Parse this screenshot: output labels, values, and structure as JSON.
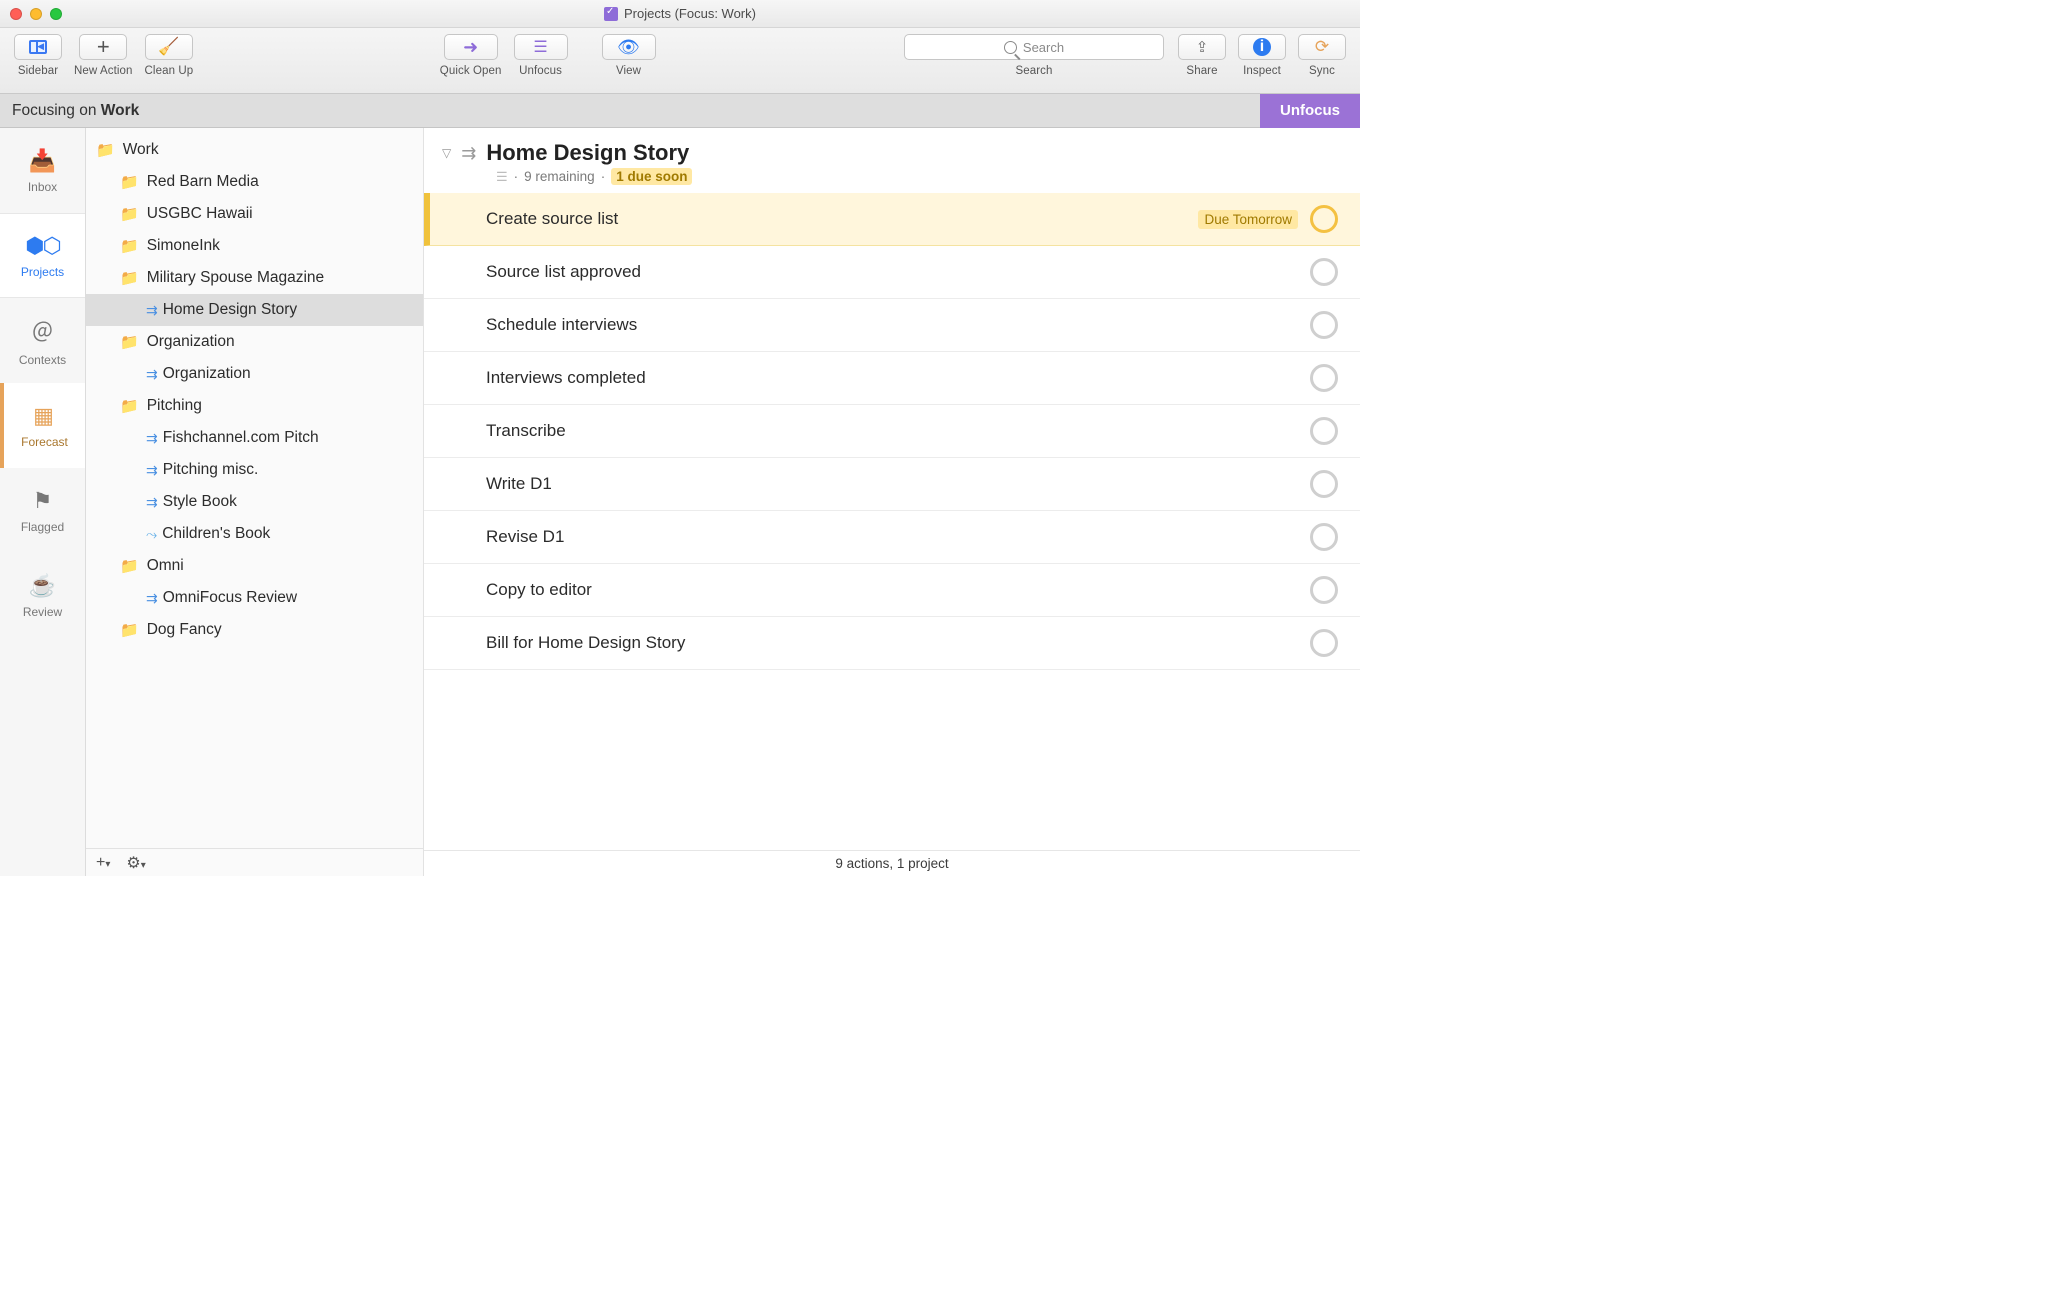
{
  "window": {
    "title": "Projects (Focus: Work)"
  },
  "toolbar": {
    "sidebar": "Sidebar",
    "new_action": "New Action",
    "clean_up": "Clean Up",
    "quick_open": "Quick Open",
    "unfocus": "Unfocus",
    "view": "View",
    "search_placeholder": "Search",
    "search_label": "Search",
    "share": "Share",
    "inspect": "Inspect",
    "sync": "Sync"
  },
  "focus_strip": {
    "prefix": "Focusing on ",
    "name": "Work",
    "unfocus": "Unfocus"
  },
  "rail": {
    "inbox": "Inbox",
    "projects": "Projects",
    "contexts": "Contexts",
    "forecast": "Forecast",
    "flagged": "Flagged",
    "review": "Review"
  },
  "projects": [
    {
      "type": "folder",
      "level": 0,
      "name": "Work"
    },
    {
      "type": "folder",
      "level": 1,
      "name": "Red Barn Media"
    },
    {
      "type": "folder",
      "level": 1,
      "name": "USGBC Hawaii"
    },
    {
      "type": "folder",
      "level": 1,
      "name": "SimoneInk"
    },
    {
      "type": "folder",
      "level": 1,
      "name": "Military Spouse Magazine"
    },
    {
      "type": "project",
      "level": 2,
      "name": "Home Design Story",
      "selected": true
    },
    {
      "type": "folder",
      "level": 1,
      "name": "Organization"
    },
    {
      "type": "project",
      "level": 2,
      "name": "Organization"
    },
    {
      "type": "folder",
      "level": 1,
      "name": "Pitching"
    },
    {
      "type": "project",
      "level": 2,
      "name": "Fishchannel.com Pitch"
    },
    {
      "type": "project",
      "level": 2,
      "name": "Pitching misc."
    },
    {
      "type": "project",
      "level": 2,
      "name": "Style Book"
    },
    {
      "type": "project-single",
      "level": 2,
      "name": "Children's Book"
    },
    {
      "type": "folder",
      "level": 1,
      "name": "Omni"
    },
    {
      "type": "project",
      "level": 2,
      "name": "OmniFocus Review"
    },
    {
      "type": "folder",
      "level": 1,
      "name": "Dog Fancy"
    }
  ],
  "outline": {
    "title": "Home Design Story",
    "remaining": "9 remaining",
    "due_soon_chip": "1 due soon",
    "tasks": [
      {
        "name": "Create source list",
        "due": true,
        "due_label": "Due Tomorrow"
      },
      {
        "name": "Source list approved"
      },
      {
        "name": "Schedule interviews"
      },
      {
        "name": "Interviews completed"
      },
      {
        "name": "Transcribe"
      },
      {
        "name": "Write D1"
      },
      {
        "name": "Revise D1"
      },
      {
        "name": "Copy to editor"
      },
      {
        "name": "Bill for Home Design Story"
      }
    ]
  },
  "statusbar": "9 actions, 1 project"
}
